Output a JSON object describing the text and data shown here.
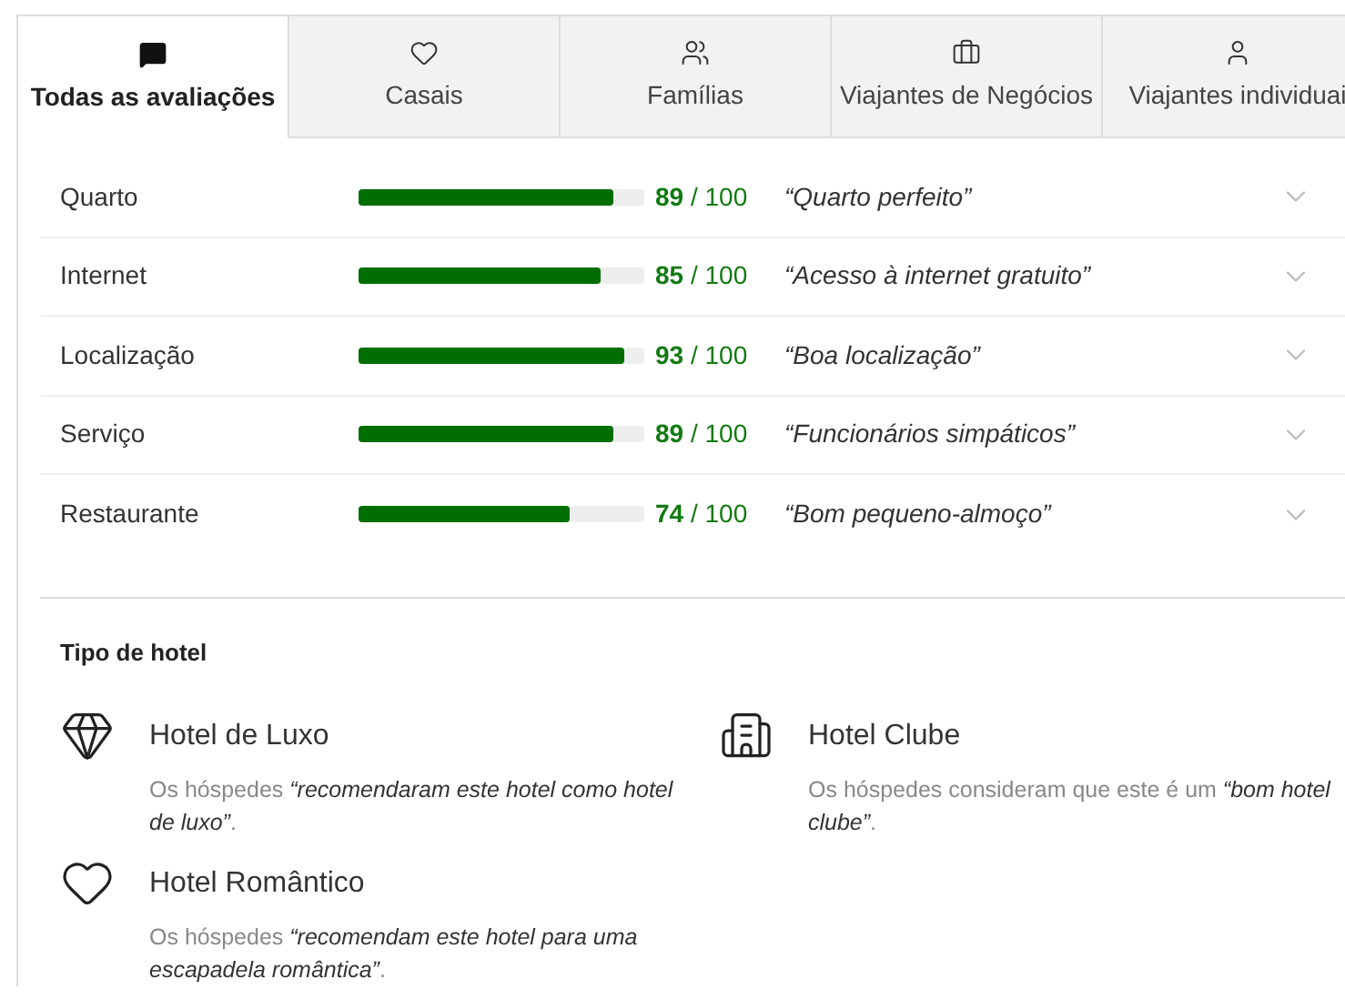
{
  "tabs": [
    {
      "label": "Todas as avaliações",
      "kind": "chat",
      "selected": true
    },
    {
      "label": "Casais",
      "kind": "heart",
      "selected": false
    },
    {
      "label": "Famílias",
      "kind": "family",
      "selected": false
    },
    {
      "label": "Viajantes de Negócios",
      "kind": "briefcase",
      "selected": false
    },
    {
      "label": "Viajantes individuai",
      "kind": "person",
      "selected": false
    }
  ],
  "ratings": [
    {
      "name": "Quarto",
      "level": 0.89,
      "score": "89",
      "out_of": "/ 100",
      "quote": "“Quarto perfeito”"
    },
    {
      "name": "Internet",
      "level": 0.85,
      "score": "85",
      "out_of": "/ 100",
      "quote": "“Acesso à internet gratuito”"
    },
    {
      "name": "Localização",
      "level": 0.93,
      "score": "93",
      "out_of": "/ 100",
      "quote": "“Boa localização”"
    },
    {
      "name": "Serviço",
      "level": 0.89,
      "score": "89",
      "out_of": "/ 100",
      "quote": "“Funcionários simpáticos”"
    },
    {
      "name": "Restaurante",
      "level": 0.74,
      "score": "74",
      "out_of": "/ 100",
      "quote": "“Bom pequeno-almoço”"
    }
  ],
  "hotel_type": {
    "heading": "Tipo de hotel",
    "items": [
      {
        "kind": "diamond",
        "title": "Hotel de Luxo",
        "description": "Os hóspedes *“recomendaram este hotel como hotel de luxo”*."
      },
      {
        "kind": "building",
        "title": "Hotel Clube",
        "description": "Os hóspedes consideram que este é um *“bom hotel clube”*."
      },
      {
        "kind": "heart",
        "title": "Hotel Romântico",
        "description": "Os hóspedes *“recomendam este hotel para uma escapadela romântica”*."
      }
    ]
  }
}
